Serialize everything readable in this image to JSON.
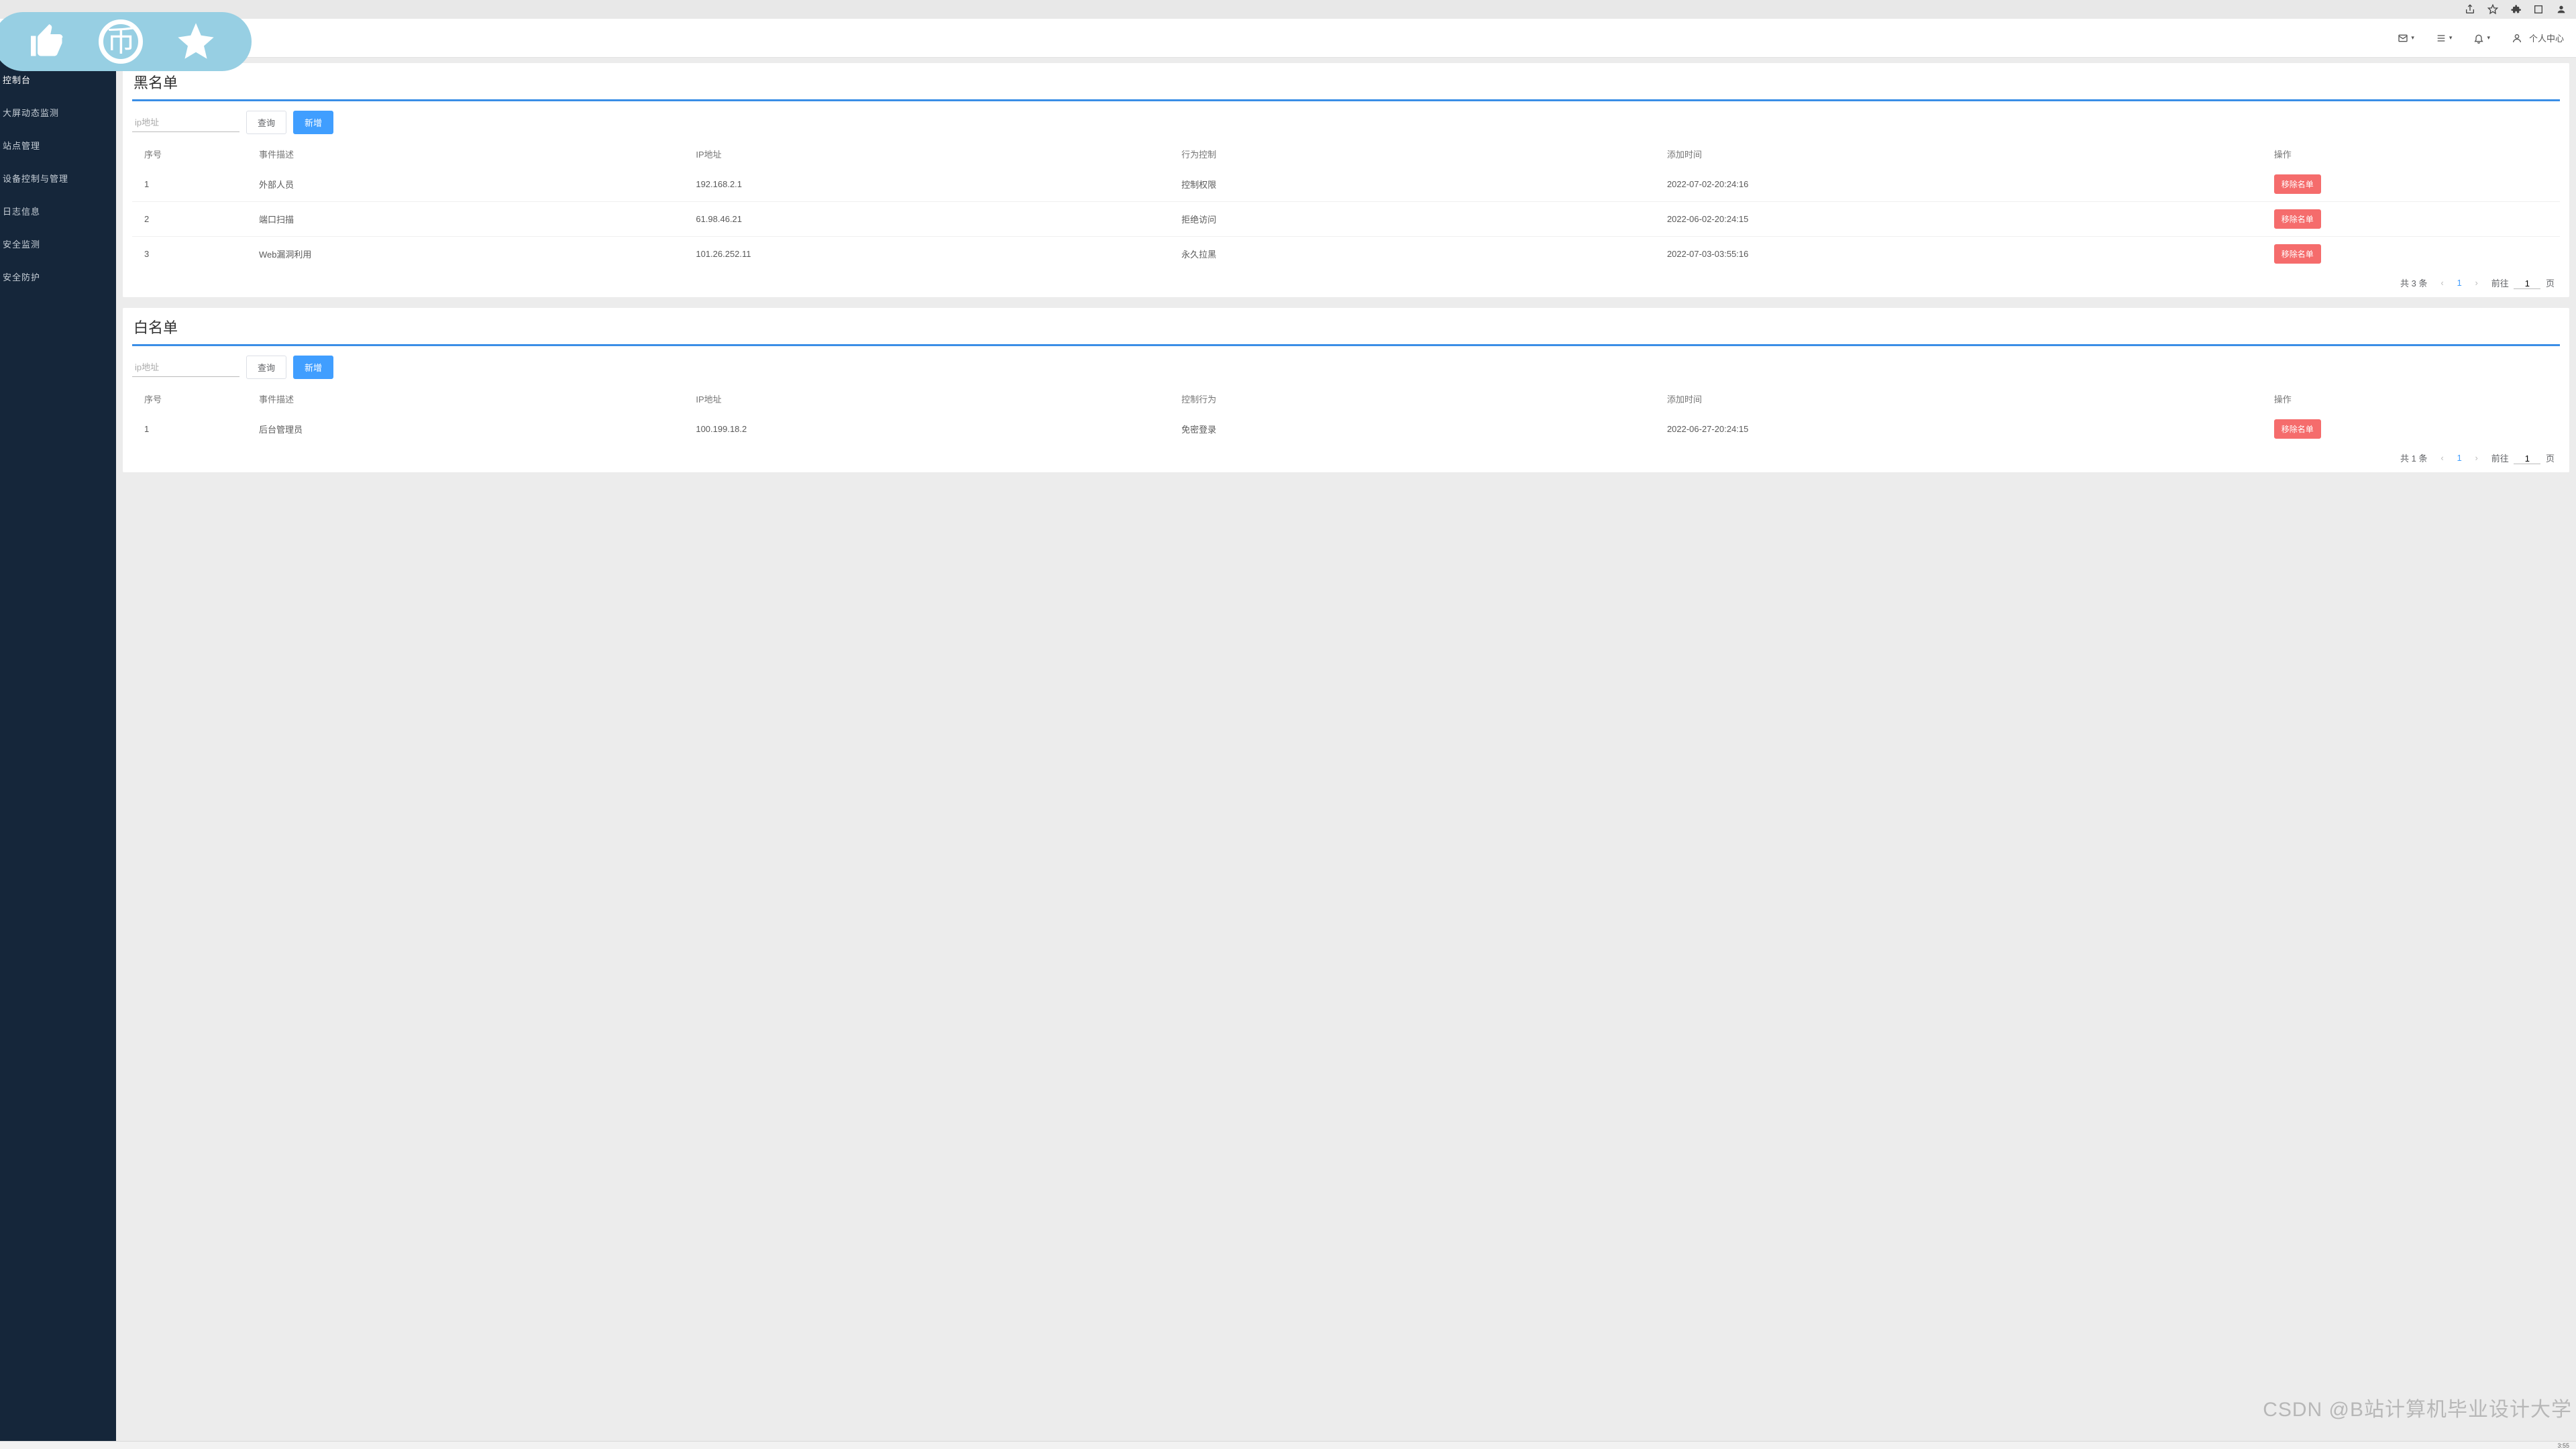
{
  "header": {
    "profile": "个人中心"
  },
  "sidebar": {
    "title": "控制台",
    "items": [
      {
        "label": "大屏动态监测"
      },
      {
        "label": "站点管理"
      },
      {
        "label": "设备控制与管理"
      },
      {
        "label": "日志信息"
      },
      {
        "label": "安全监测"
      },
      {
        "label": "安全防护"
      }
    ]
  },
  "blacklist": {
    "title": "黑名单",
    "search_placeholder": "ip地址",
    "query_btn": "查询",
    "add_btn": "新增",
    "columns": {
      "seq": "序号",
      "desc": "事件描述",
      "ip": "IP地址",
      "ctrl": "行为控制",
      "time": "添加时间",
      "act": "操作"
    },
    "remove_btn": "移除名单",
    "rows": [
      {
        "seq": "1",
        "desc": "外部人员",
        "ip": "192.168.2.1",
        "ctrl": "控制权限",
        "time": "2022-07-02-20:24:16"
      },
      {
        "seq": "2",
        "desc": "端口扫描",
        "ip": "61.98.46.21",
        "ctrl": "拒绝访问",
        "time": "2022-06-02-20:24:15"
      },
      {
        "seq": "3",
        "desc": "Web漏洞利用",
        "ip": "101.26.252.11",
        "ctrl": "永久拉黑",
        "time": "2022-07-03-03:55:16"
      }
    ],
    "pagination": {
      "total": "共 3 条",
      "page": "1",
      "goto_prefix": "前往",
      "goto_value": "1",
      "goto_suffix": "页"
    }
  },
  "whitelist": {
    "title": "白名单",
    "search_placeholder": "ip地址",
    "query_btn": "查询",
    "add_btn": "新增",
    "columns": {
      "seq": "序号",
      "desc": "事件描述",
      "ip": "IP地址",
      "ctrl": "控制行为",
      "time": "添加时间",
      "act": "操作"
    },
    "remove_btn": "移除名单",
    "rows": [
      {
        "seq": "1",
        "desc": "后台管理员",
        "ip": "100.199.18.2",
        "ctrl": "免密登录",
        "time": "2022-06-27-20:24:15"
      }
    ],
    "pagination": {
      "total": "共 1 条",
      "page": "1",
      "goto_prefix": "前往",
      "goto_value": "1",
      "goto_suffix": "页"
    }
  },
  "watermark": "CSDN @B站计算机毕业设计大学",
  "taskbar": {
    "clock": "3:55"
  }
}
